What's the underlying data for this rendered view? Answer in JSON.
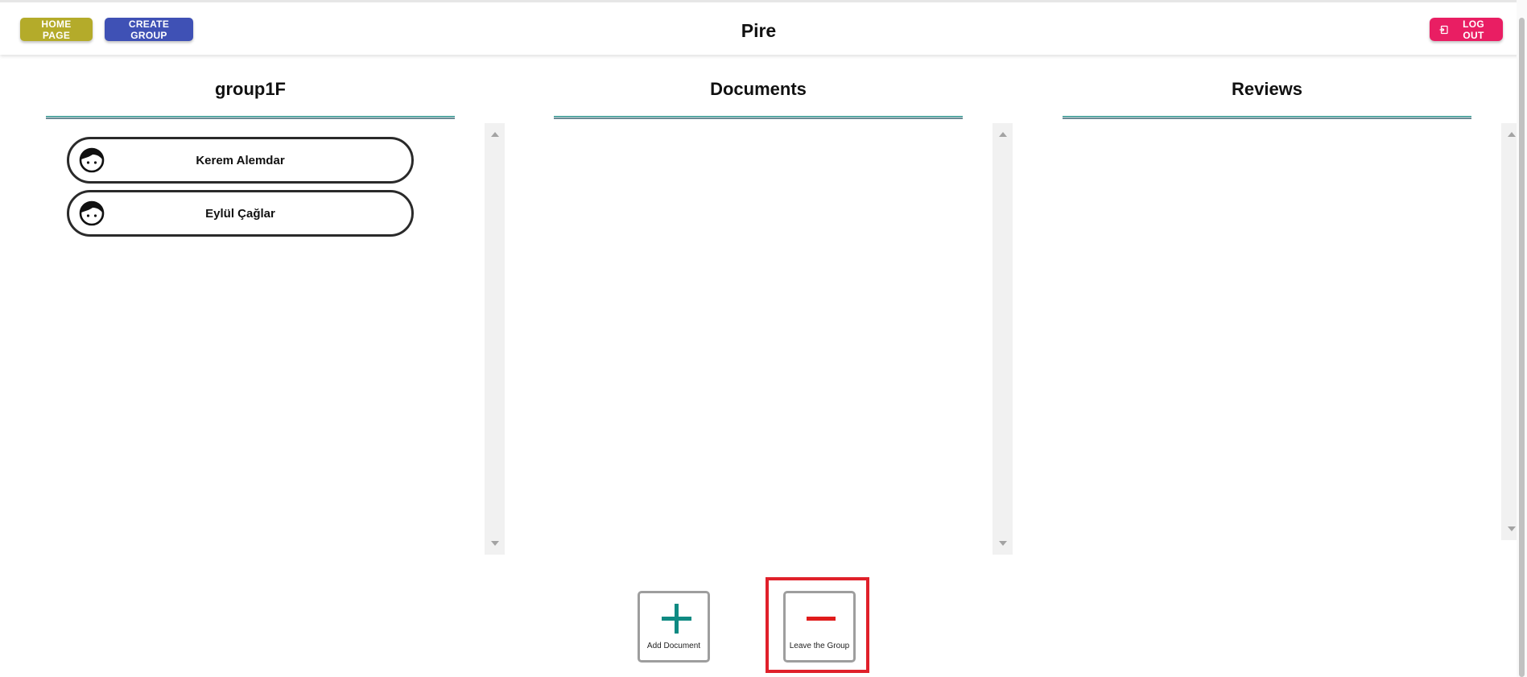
{
  "header": {
    "home_label": "HOME PAGE",
    "create_label": "CREATE GROUP",
    "app_title": "Pire",
    "logout_label": "LOG OUT"
  },
  "columns": {
    "group": {
      "title": "group1F"
    },
    "documents": {
      "title": "Documents"
    },
    "reviews": {
      "title": "Reviews"
    }
  },
  "members": [
    {
      "name": "Kerem Alemdar",
      "icon": "user-face-icon"
    },
    {
      "name": "Eylül Çağlar",
      "icon": "user-face-icon"
    }
  ],
  "actions": {
    "add": {
      "label": "Add Document",
      "icon": "plus-icon",
      "color": "#0f8a82"
    },
    "leave": {
      "label": "Leave the Group",
      "icon": "minus-icon",
      "color": "#e01b1b"
    }
  },
  "colors": {
    "home": "#b4ab2a",
    "create": "#3f51b5",
    "logout": "#e91e63",
    "highlight": "#e0202a"
  }
}
